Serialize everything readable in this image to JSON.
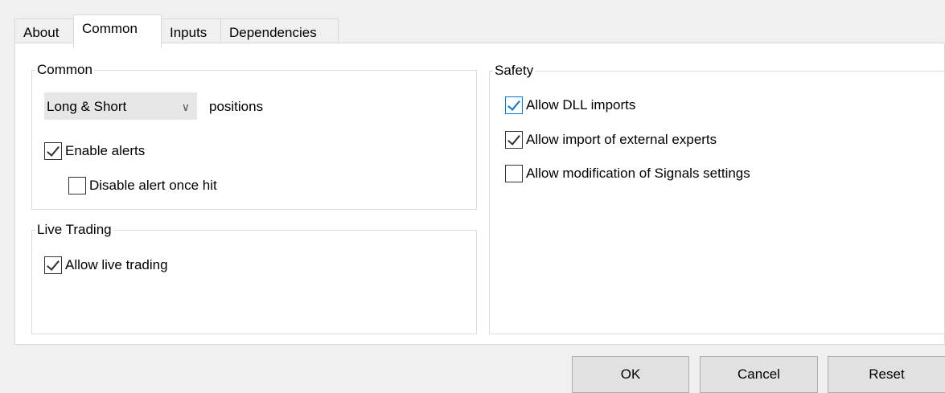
{
  "tabs": [
    {
      "label": "About"
    },
    {
      "label": "Common"
    },
    {
      "label": "Inputs"
    },
    {
      "label": "Dependencies"
    }
  ],
  "active_tab": "Common",
  "common": {
    "title": "Common",
    "positions_select": {
      "value": "Long & Short",
      "suffix": "positions"
    },
    "enable_alerts": {
      "label": "Enable alerts",
      "checked": true
    },
    "disable_alert_once_hit": {
      "label": "Disable alert once hit",
      "checked": false
    }
  },
  "live_trading": {
    "title": "Live Trading",
    "allow_live_trading": {
      "label": "Allow live trading",
      "checked": true
    }
  },
  "safety": {
    "title": "Safety",
    "allow_dll_imports": {
      "label": "Allow DLL imports",
      "checked": true
    },
    "allow_import_external_experts": {
      "label": "Allow import of external experts",
      "checked": true
    },
    "allow_modification_signals": {
      "label": "Allow modification of Signals settings",
      "checked": false
    }
  },
  "buttons": {
    "ok": "OK",
    "cancel": "Cancel",
    "reset": "Reset"
  },
  "icons": {
    "dropdown": "chevron-down-icon",
    "checkbox": "checkmark-icon"
  },
  "colors": {
    "focus_accent": "#0078d7",
    "panel_bg": "#ffffff",
    "window_bg": "#f0f0f0",
    "button_bg": "#e1e1e1"
  }
}
